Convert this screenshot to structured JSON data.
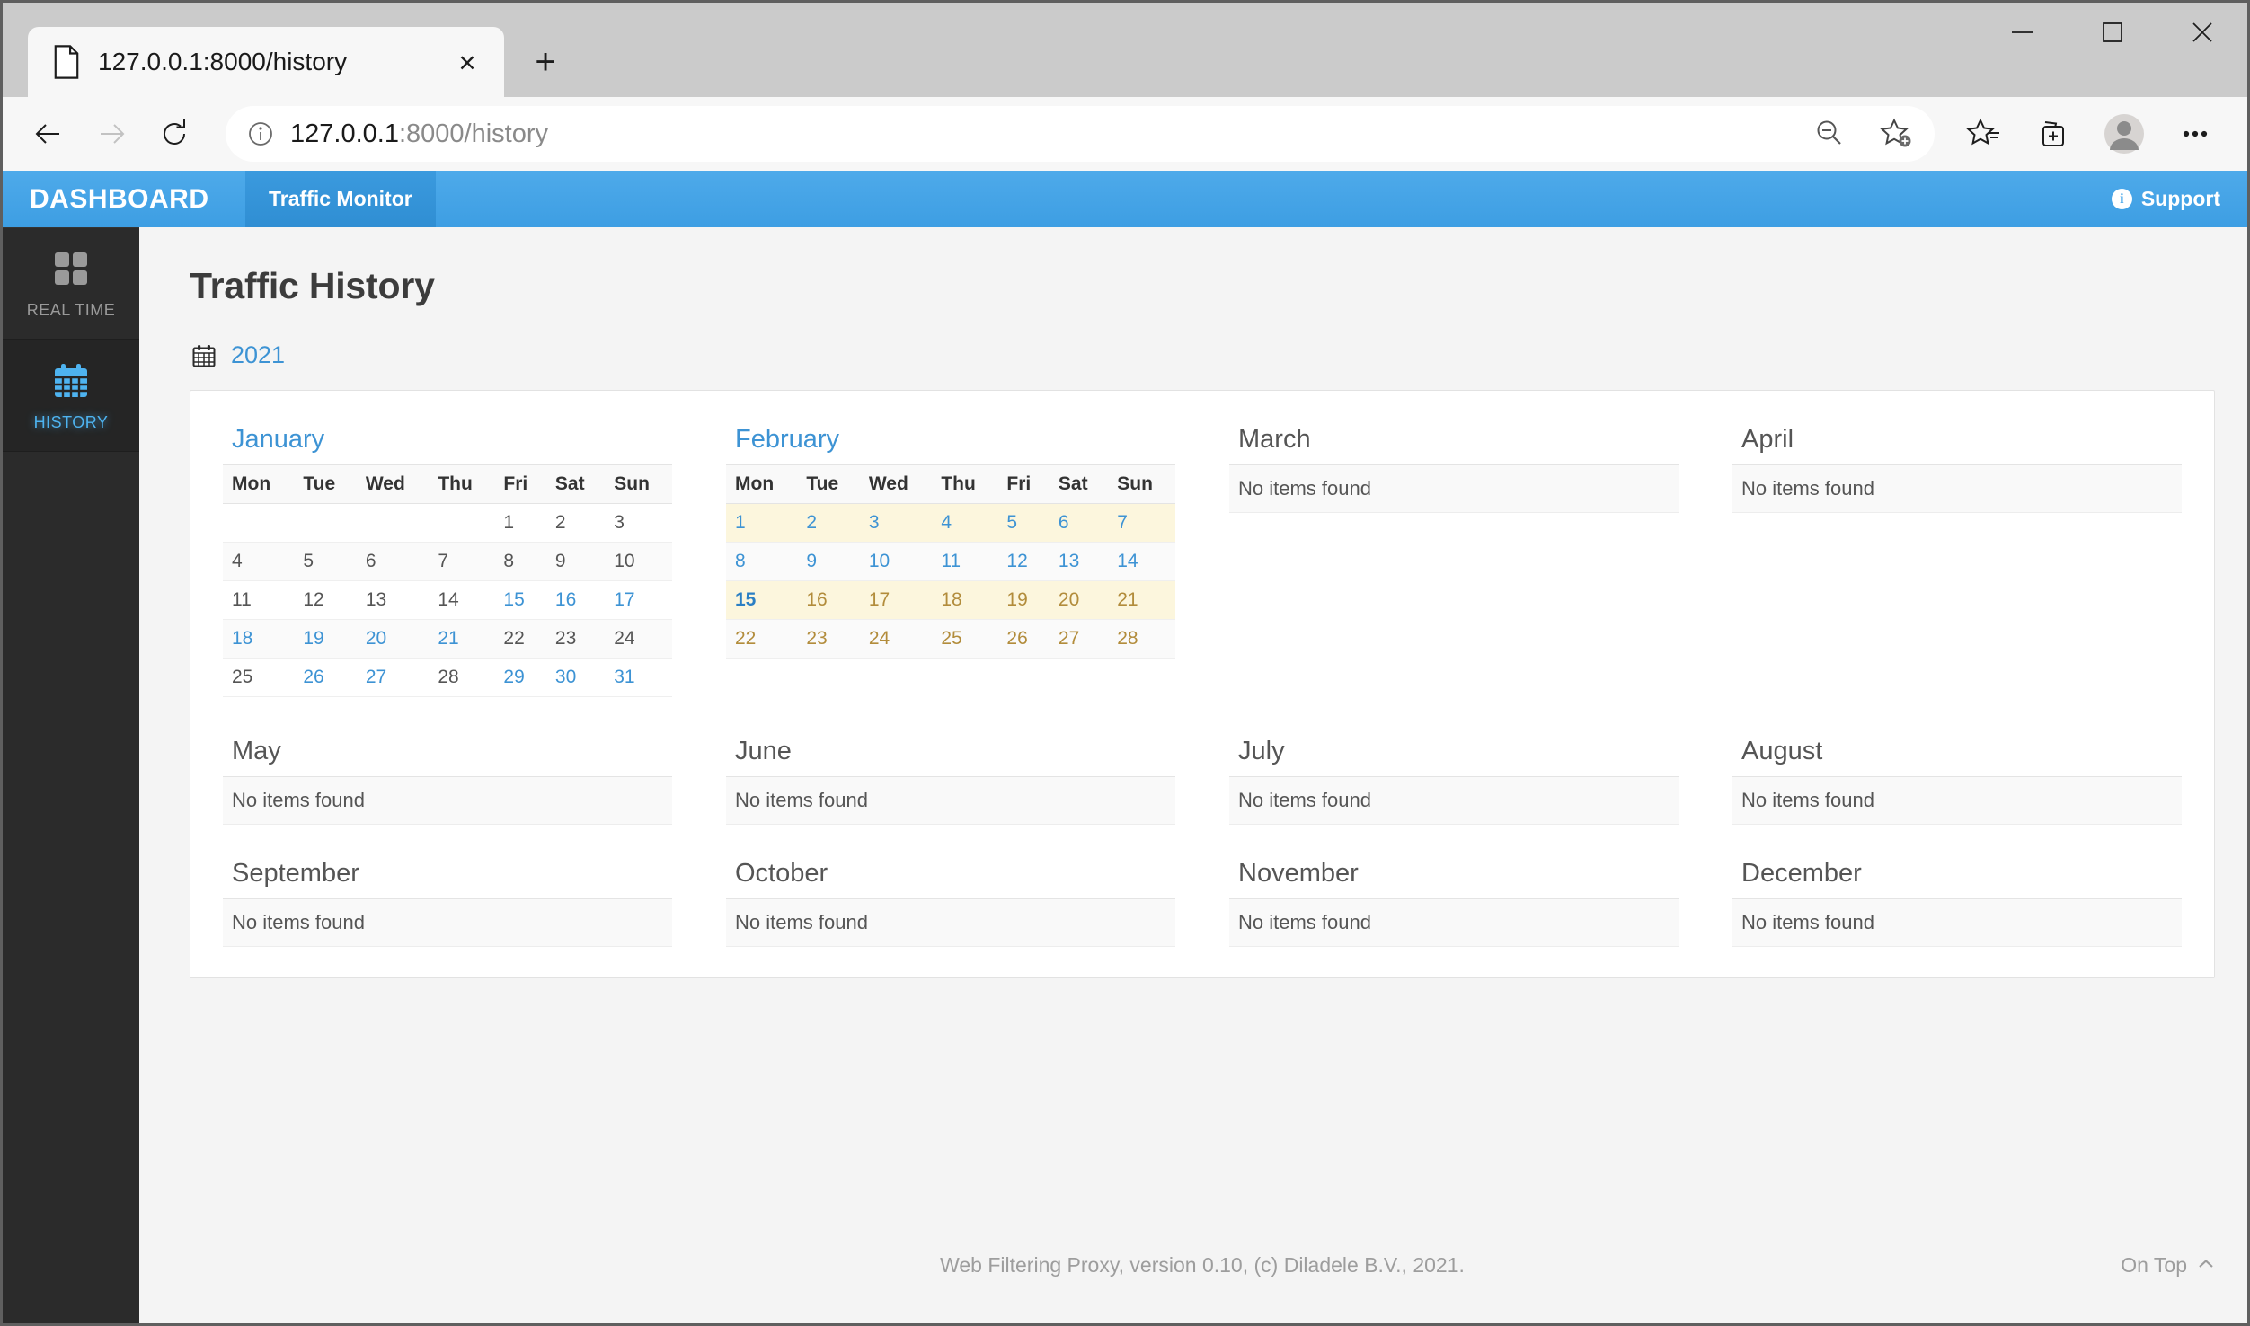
{
  "browser": {
    "tab": {
      "title": "127.0.0.1:8000/history",
      "favicon": "page-icon",
      "close": "×"
    },
    "newtab_label": "+",
    "window_controls": {
      "minimize": "minimize-icon",
      "maximize": "maximize-icon",
      "close": "close-icon"
    },
    "nav": {
      "back": "back-arrow-icon",
      "forward": "forward-arrow-icon",
      "reload": "reload-icon"
    },
    "url": {
      "prefix": "127.0.0.1",
      "suffix": ":8000/history",
      "full": "127.0.0.1:8000/history",
      "info_icon": "info-icon"
    },
    "url_actions": [
      {
        "name": "zoom-out-icon",
        "label": "Zoom out"
      },
      {
        "name": "add-favorite-icon",
        "label": "Add this page to favorites"
      }
    ],
    "toolbar_icons": [
      {
        "name": "favorites-icon",
        "label": "Favorites"
      },
      {
        "name": "collections-icon",
        "label": "Collections"
      },
      {
        "name": "profile-avatar-icon",
        "label": "Profile"
      },
      {
        "name": "settings-more-icon",
        "label": "Settings and more"
      }
    ]
  },
  "appnav": {
    "brand": "DASHBOARD",
    "tabs": [
      {
        "label": "Traffic Monitor",
        "active": true
      }
    ],
    "support": {
      "label": "Support",
      "icon": "info-icon"
    }
  },
  "sidebar": {
    "items": [
      {
        "label": "REAL TIME",
        "icon": "grid-squares-icon",
        "active": false
      },
      {
        "label": "HISTORY",
        "icon": "calendar-icon",
        "active": true
      }
    ]
  },
  "page": {
    "title": "Traffic History",
    "year": "2021",
    "year_icon": "calendar-icon",
    "no_items_text": "No items found",
    "weekday_headers": [
      "Mon",
      "Tue",
      "Wed",
      "Thu",
      "Fri",
      "Sat",
      "Sun"
    ]
  },
  "colors": {
    "accent_blue": "#3d93d4",
    "navbar_blue": "#4eaaea",
    "navbar_active_blue": "#3b9ade",
    "sidebar_dark": "#2b2b2b",
    "sidebar_active_text": "#4eb3f0",
    "highlight_yellow": "#fcf6dd",
    "dim_day": "#b28c3b",
    "link_day": "#3d93d4",
    "plain_day": "#555555"
  },
  "months": [
    {
      "name": "January",
      "has_days": true,
      "title_is_link": true,
      "weeks": [
        {
          "striped": false,
          "highlight": false,
          "days": [
            {
              "d": "",
              "s": "empty"
            },
            {
              "d": "",
              "s": "empty"
            },
            {
              "d": "",
              "s": "empty"
            },
            {
              "d": "",
              "s": "empty"
            },
            {
              "d": "1",
              "s": "plain"
            },
            {
              "d": "2",
              "s": "plain"
            },
            {
              "d": "3",
              "s": "plain"
            }
          ]
        },
        {
          "striped": true,
          "highlight": false,
          "days": [
            {
              "d": "4",
              "s": "plain"
            },
            {
              "d": "5",
              "s": "plain"
            },
            {
              "d": "6",
              "s": "plain"
            },
            {
              "d": "7",
              "s": "plain"
            },
            {
              "d": "8",
              "s": "plain"
            },
            {
              "d": "9",
              "s": "plain"
            },
            {
              "d": "10",
              "s": "plain"
            }
          ]
        },
        {
          "striped": false,
          "highlight": false,
          "days": [
            {
              "d": "11",
              "s": "plain"
            },
            {
              "d": "12",
              "s": "plain"
            },
            {
              "d": "13",
              "s": "plain"
            },
            {
              "d": "14",
              "s": "plain"
            },
            {
              "d": "15",
              "s": "link"
            },
            {
              "d": "16",
              "s": "link"
            },
            {
              "d": "17",
              "s": "link"
            }
          ]
        },
        {
          "striped": true,
          "highlight": false,
          "days": [
            {
              "d": "18",
              "s": "link"
            },
            {
              "d": "19",
              "s": "link"
            },
            {
              "d": "20",
              "s": "link"
            },
            {
              "d": "21",
              "s": "link"
            },
            {
              "d": "22",
              "s": "plain"
            },
            {
              "d": "23",
              "s": "plain"
            },
            {
              "d": "24",
              "s": "plain"
            }
          ]
        },
        {
          "striped": false,
          "highlight": false,
          "days": [
            {
              "d": "25",
              "s": "plain"
            },
            {
              "d": "26",
              "s": "link"
            },
            {
              "d": "27",
              "s": "link"
            },
            {
              "d": "28",
              "s": "plain"
            },
            {
              "d": "29",
              "s": "link"
            },
            {
              "d": "30",
              "s": "link"
            },
            {
              "d": "31",
              "s": "link"
            }
          ]
        }
      ]
    },
    {
      "name": "February",
      "has_days": true,
      "title_is_link": true,
      "weeks": [
        {
          "striped": false,
          "highlight": true,
          "days": [
            {
              "d": "1",
              "s": "link"
            },
            {
              "d": "2",
              "s": "link"
            },
            {
              "d": "3",
              "s": "link"
            },
            {
              "d": "4",
              "s": "link"
            },
            {
              "d": "5",
              "s": "link"
            },
            {
              "d": "6",
              "s": "link"
            },
            {
              "d": "7",
              "s": "link"
            }
          ]
        },
        {
          "striped": true,
          "highlight": false,
          "days": [
            {
              "d": "8",
              "s": "link"
            },
            {
              "d": "9",
              "s": "link"
            },
            {
              "d": "10",
              "s": "link"
            },
            {
              "d": "11",
              "s": "link"
            },
            {
              "d": "12",
              "s": "link"
            },
            {
              "d": "13",
              "s": "link"
            },
            {
              "d": "14",
              "s": "link"
            }
          ]
        },
        {
          "striped": false,
          "highlight": true,
          "days": [
            {
              "d": "15",
              "s": "today"
            },
            {
              "d": "16",
              "s": "dim"
            },
            {
              "d": "17",
              "s": "dim"
            },
            {
              "d": "18",
              "s": "dim"
            },
            {
              "d": "19",
              "s": "dim"
            },
            {
              "d": "20",
              "s": "dim"
            },
            {
              "d": "21",
              "s": "dim"
            }
          ]
        },
        {
          "striped": true,
          "highlight": false,
          "days": [
            {
              "d": "22",
              "s": "dim"
            },
            {
              "d": "23",
              "s": "dim"
            },
            {
              "d": "24",
              "s": "dim"
            },
            {
              "d": "25",
              "s": "dim"
            },
            {
              "d": "26",
              "s": "dim"
            },
            {
              "d": "27",
              "s": "dim"
            },
            {
              "d": "28",
              "s": "dim"
            }
          ]
        }
      ]
    },
    {
      "name": "March",
      "has_days": false,
      "title_is_link": false,
      "empty_text": "No items found"
    },
    {
      "name": "April",
      "has_days": false,
      "title_is_link": false,
      "empty_text": "No items found"
    },
    {
      "name": "May",
      "has_days": false,
      "title_is_link": false,
      "empty_text": "No items found"
    },
    {
      "name": "June",
      "has_days": false,
      "title_is_link": false,
      "empty_text": "No items found"
    },
    {
      "name": "July",
      "has_days": false,
      "title_is_link": false,
      "empty_text": "No items found"
    },
    {
      "name": "August",
      "has_days": false,
      "title_is_link": false,
      "empty_text": "No items found"
    },
    {
      "name": "September",
      "has_days": false,
      "title_is_link": false,
      "empty_text": "No items found"
    },
    {
      "name": "October",
      "has_days": false,
      "title_is_link": false,
      "empty_text": "No items found"
    },
    {
      "name": "November",
      "has_days": false,
      "title_is_link": false,
      "empty_text": "No items found"
    },
    {
      "name": "December",
      "has_days": false,
      "title_is_link": false,
      "empty_text": "No items found"
    }
  ],
  "footer": {
    "text": "Web Filtering Proxy, version 0.10, (c) Diladele B.V., 2021.",
    "ontop_label": "On Top",
    "ontop_caret": "caret-up-icon"
  }
}
